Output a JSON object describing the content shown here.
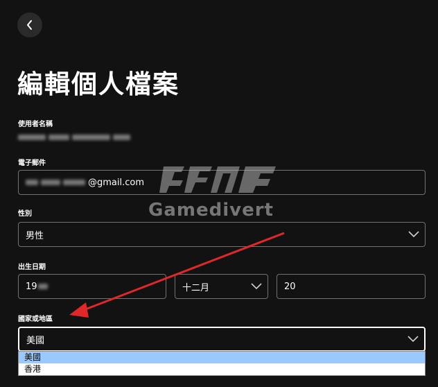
{
  "page": {
    "title": "編輯個人檔案"
  },
  "fields": {
    "username": {
      "label": "使用者名稱"
    },
    "email": {
      "label": "電子郵件",
      "value_suffix": "@gmail.com"
    },
    "gender": {
      "label": "性別",
      "value": "男性"
    },
    "birthdate": {
      "label": "出生日期",
      "year_value": "19",
      "month_value": "十二月",
      "day_value": "20"
    },
    "country": {
      "label": "國家或地區",
      "value": "美國",
      "options": [
        "美國",
        "香港"
      ],
      "selected_index": 0
    }
  },
  "watermark": {
    "text": "Gamedivert"
  },
  "colors": {
    "background": "#121212",
    "input_border": "#727272",
    "selected_option": "#99c9ff",
    "arrow": "#e0282b"
  },
  "icons": {
    "back": "chevron-left-icon",
    "dropdown": "chevron-down-icon"
  }
}
